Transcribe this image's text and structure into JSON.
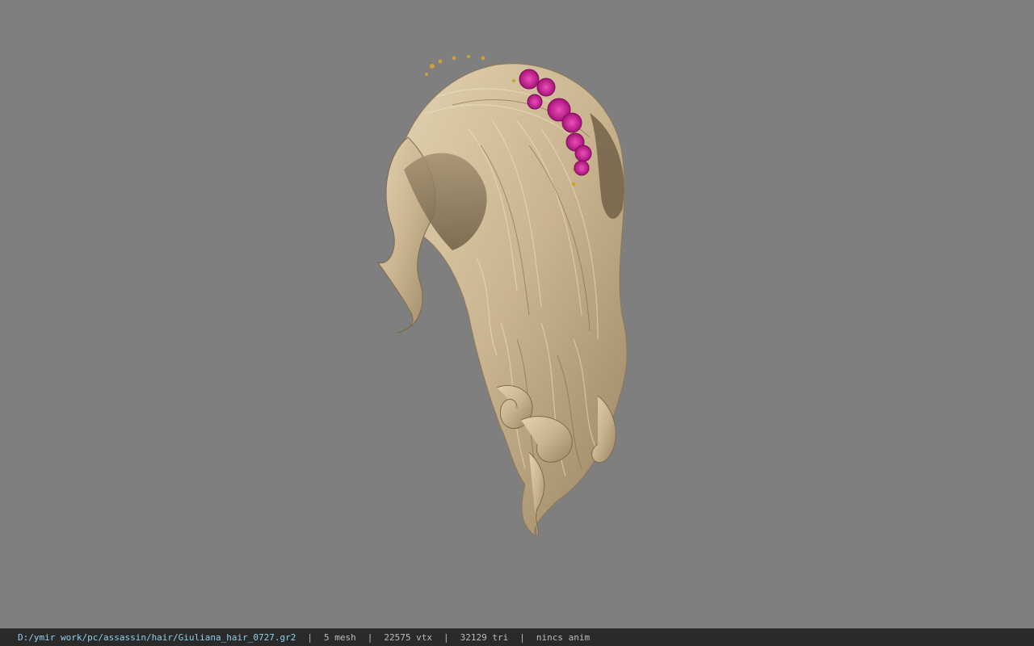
{
  "viewer": {
    "background_color": "#7f7f7f",
    "model_name": "hair-model"
  },
  "status_bar": {
    "file_path": "D:/ymir work/pc/assassin/hair/Giuliana_hair_0727.gr2",
    "separator": "|",
    "mesh_count": "5 mesh",
    "vertex_count": "22575 vtx",
    "triangle_count": "32129 tri",
    "anim_status": "nincs anim",
    "colors": {
      "background": "#2a2a2a",
      "path_text": "#8fd0ec",
      "info_text": "#bdbdbd"
    }
  }
}
